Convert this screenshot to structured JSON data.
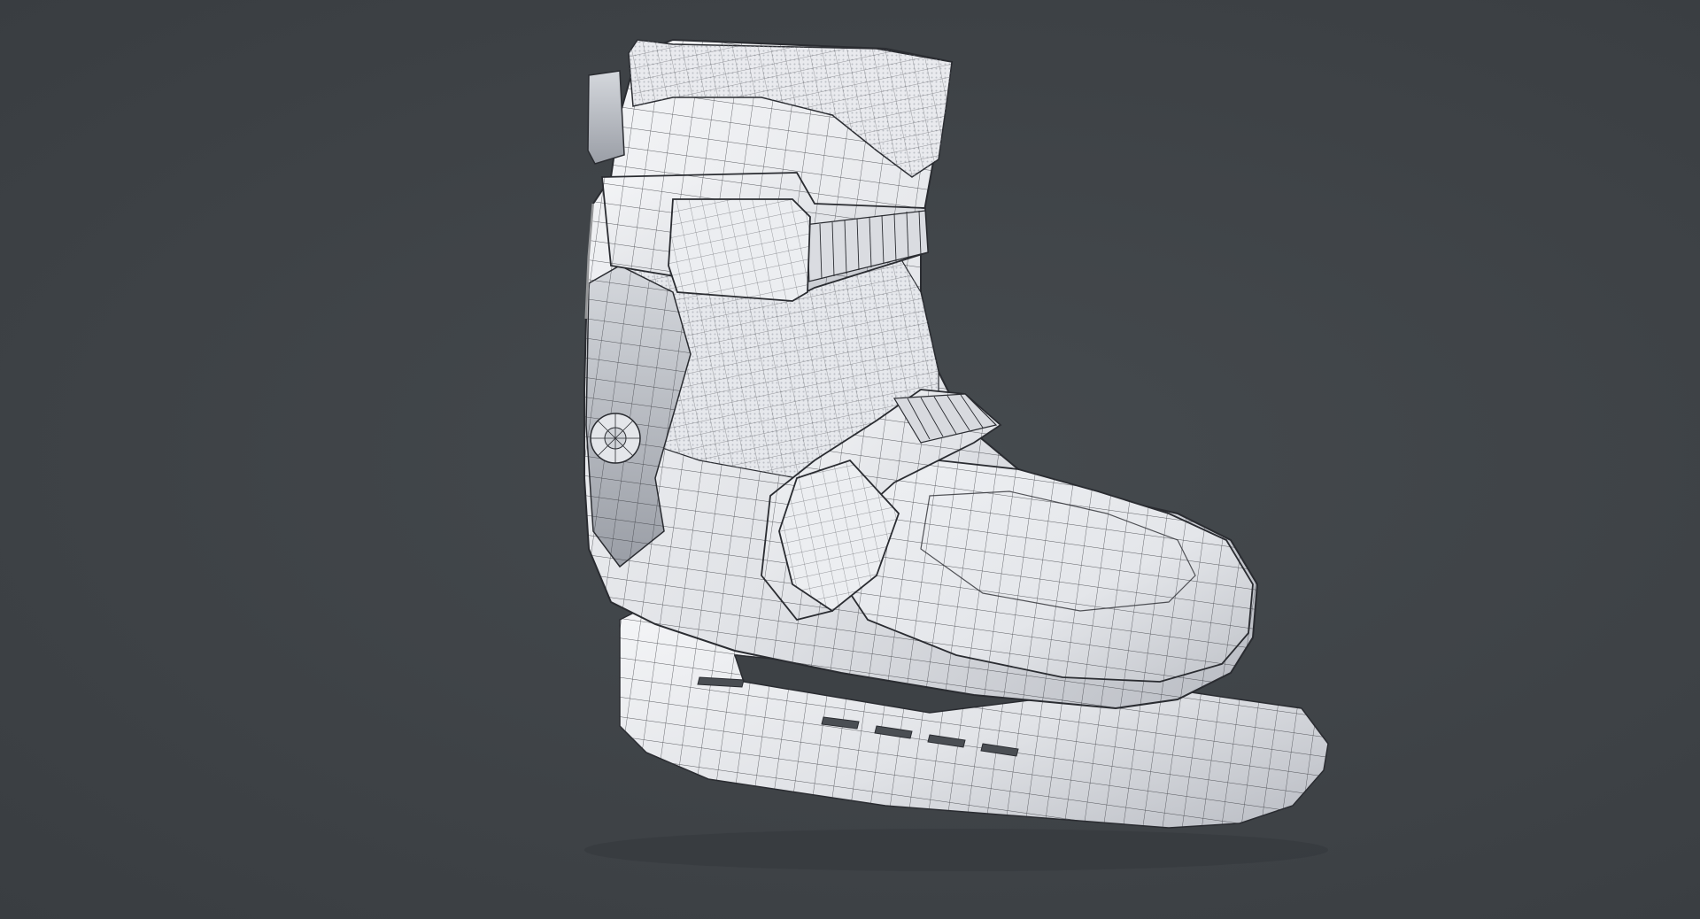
{
  "scene": {
    "subject": "ice-skate",
    "render_style": "wireframe-on-clay",
    "colors": {
      "background": "#3f4347",
      "clay_light": "#f1f2f5",
      "clay_mid": "#d9dbe0",
      "clay_shadow": "#a7aab2",
      "wire": "#2a2c31"
    }
  }
}
